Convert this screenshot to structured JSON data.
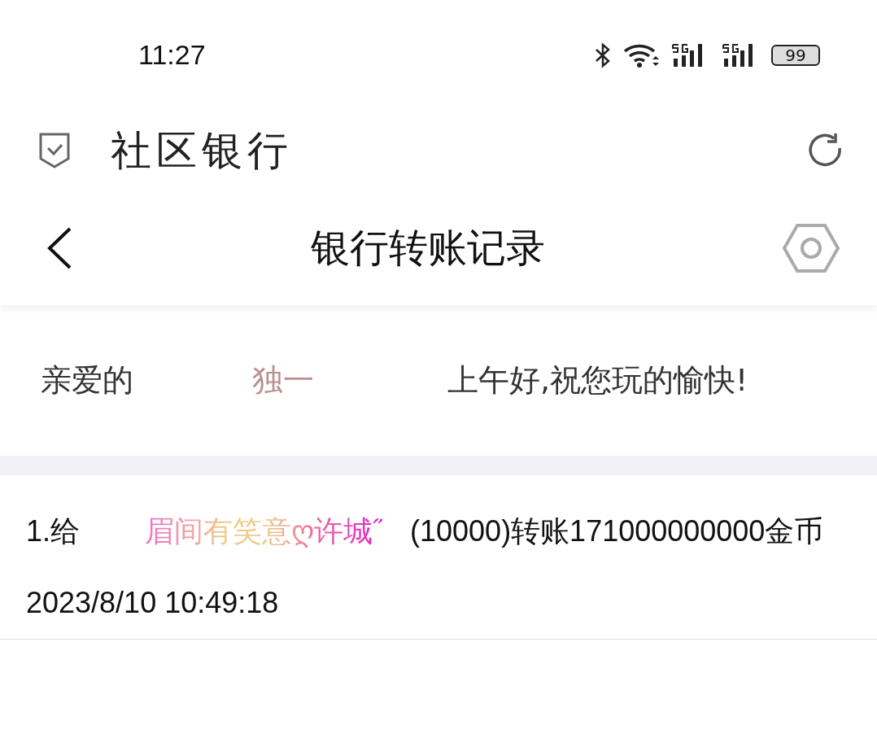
{
  "status_bar": {
    "time": "11:27",
    "battery": "99"
  },
  "app_bar": {
    "title": "社区银行"
  },
  "nav_bar": {
    "title": "银行转账记录"
  },
  "greeting": {
    "salutation": "亲爱的",
    "name": "独一",
    "message": "上午好,祝您玩的愉快!"
  },
  "records": [
    {
      "prefix": "1.给",
      "recipient": "眉间有笑意ღ许城˝",
      "detail": "(10000)转账171000000000金币",
      "time": "2023/8/10 10:49:18"
    }
  ]
}
